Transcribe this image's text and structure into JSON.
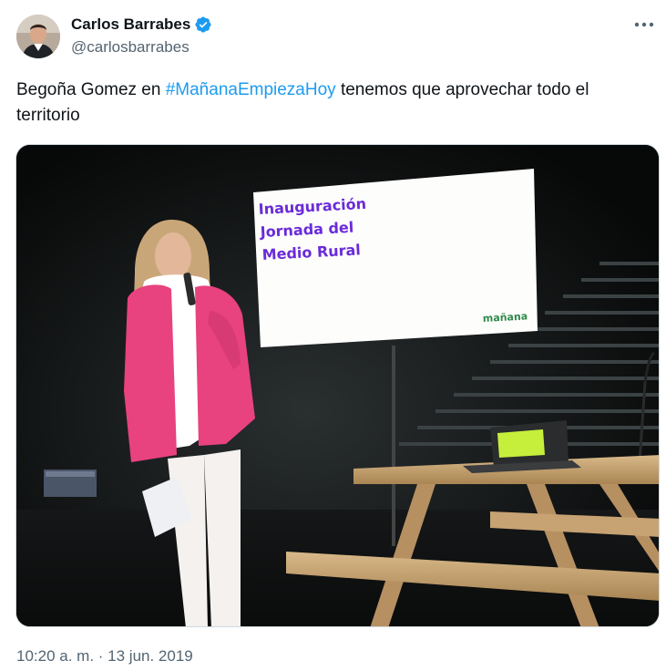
{
  "author": {
    "display_name": "Carlos Barrabes",
    "handle": "@carlosbarrabes",
    "verified": true
  },
  "tweet": {
    "text_before": "Begoña Gomez en ",
    "hashtag": "#MañanaEmpiezaHoy",
    "text_after": " tenemos que aprovechar todo el territorio"
  },
  "media": {
    "screen_line1": "Inauguración",
    "screen_line2": "Jornada del",
    "screen_line3": "Medio Rural",
    "screen_brand": "mañana"
  },
  "meta": {
    "timestamp": "10:20 a. m. · 13 jun. 2019"
  },
  "icons": {
    "verified": "verified-badge-icon",
    "more": "more-dots-icon"
  },
  "colors": {
    "link": "#1d9bf0",
    "secondary_text": "#536471",
    "verified": "#1d9bf0",
    "screen_text": "#6a2bd9",
    "jacket": "#e8427f"
  }
}
